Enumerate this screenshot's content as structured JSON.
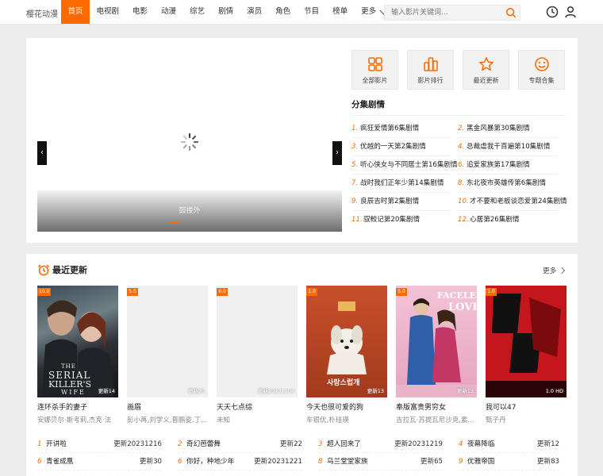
{
  "header": {
    "logo": "樱花动漫",
    "nav": [
      "首页",
      "电视剧",
      "电影",
      "动漫",
      "综艺",
      "剧情",
      "演员",
      "角色",
      "节目",
      "榜单"
    ],
    "more_label": "更多",
    "search_placeholder": "输入影片关键词...",
    "accent_color": "#ff6a00"
  },
  "slider": {
    "caption": "鼓楼外"
  },
  "quick_links": [
    {
      "label": "全部影片",
      "icon": "grid-icon"
    },
    {
      "label": "影片排行",
      "icon": "bar-chart-icon"
    },
    {
      "label": "最近更新",
      "icon": "star-icon"
    },
    {
      "label": "专题合集",
      "icon": "smile-icon"
    }
  ],
  "episodes": {
    "title": "分集剧情",
    "items": [
      {
        "num": "1.",
        "name": "疯狂爱情第6集剧情"
      },
      {
        "num": "2.",
        "name": "黑金风暴第30集剧情"
      },
      {
        "num": "3.",
        "name": "优越的一天第2集剧情"
      },
      {
        "num": "4.",
        "name": "总裁虐我千百遍第10集剧情"
      },
      {
        "num": "5.",
        "name": "听心侠女与不同居士第16集剧情"
      },
      {
        "num": "6.",
        "name": "追爱家族第17集剧情"
      },
      {
        "num": "7.",
        "name": "战时我们正年少第14集剧情"
      },
      {
        "num": "8.",
        "name": "东北夜市英雄传第6集剧情"
      },
      {
        "num": "9.",
        "name": "良辰吉时第2集剧情"
      },
      {
        "num": "10.",
        "name": "才不要和老板谈恋爱第24集剧情"
      },
      {
        "num": "11.",
        "name": "驭鲛记第20集剧情"
      },
      {
        "num": "12.",
        "name": "心居第26集剧情"
      }
    ]
  },
  "recent": {
    "title": "最近更新",
    "more": "更多",
    "cards": [
      {
        "badge": "10.0",
        "update": "更新14",
        "title": "连环杀手的妻子",
        "cast": "安娜贝尔·斯考莉,杰克·法"
      },
      {
        "badge": "5.0",
        "update": "更新20",
        "title": "画眉",
        "cast": "彭小苒,刘学义,晋鹏姿,丁..."
      },
      {
        "badge": "6.0",
        "update": "更新20231104",
        "title": "天天七点综",
        "cast": "未知"
      },
      {
        "badge": "1.0",
        "update": "更新13",
        "title": "今天也很可爱的狗",
        "cast": "车银优,朴珪瑛"
      },
      {
        "badge": "5.0",
        "update": "更新13",
        "title": "奉版富贵男穷女",
        "cast": "吉拉瓦·苏提瓦尼沙克,素..."
      },
      {
        "badge": "1.0",
        "update": "1.0 HD",
        "title": "我可以47",
        "cast": "甄子丹"
      }
    ],
    "poster_text": {
      "serial_1": "THE",
      "serial_2": "SERIAL",
      "serial_3": "KILLER'S",
      "serial_4": "WIFE",
      "faceless_1": "FACELESS",
      "faceless_2": "LOVE",
      "dog_korean": "사랑스럽개"
    },
    "rows_left": [
      {
        "num": "1",
        "name": "开讲啦",
        "update": "更新20231216"
      },
      {
        "num": "6",
        "name": "青雀成凰",
        "update": "更新30"
      }
    ],
    "rows_mid": [
      {
        "num": "2",
        "name": "奇幻芭蕾舞",
        "update": "更新22"
      },
      {
        "num": "6",
        "name": "你好，种地少年",
        "update": "更新20231221"
      }
    ],
    "rows_mid2": [
      {
        "num": "3",
        "name": "超人回来了",
        "update": "更新20231219"
      },
      {
        "num": "8",
        "name": "乌兰堂堂家族",
        "update": "更新65"
      }
    ],
    "rows_right": [
      {
        "num": "4",
        "name": "夜幕降临",
        "update": "更新12"
      },
      {
        "num": "9",
        "name": "优雅帝国",
        "update": "更新83"
      }
    ]
  }
}
